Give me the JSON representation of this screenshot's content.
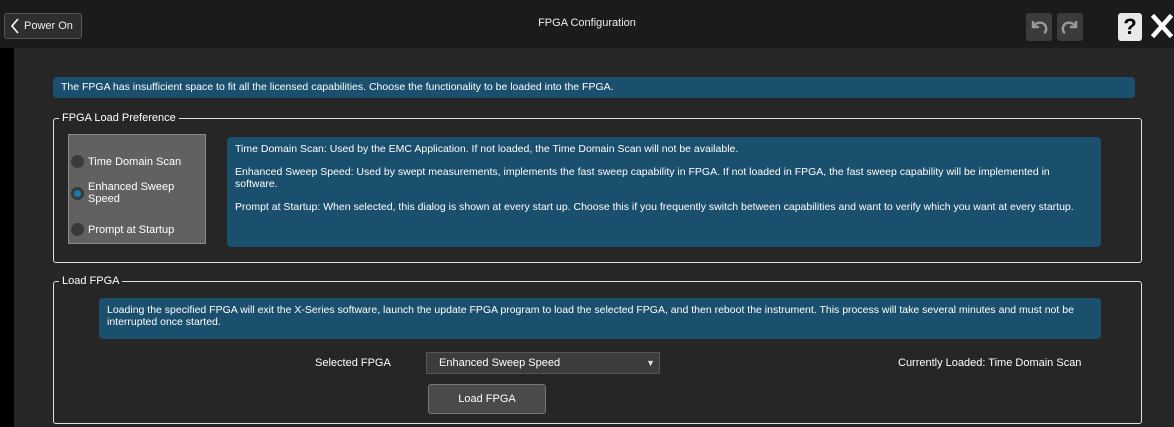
{
  "header": {
    "back_label": "Power On",
    "title": "FPGA Configuration",
    "help_label": "?"
  },
  "info": "The FPGA has insufficient space to fit all the licensed capabilities. Choose the functionality to be loaded into the FPGA.",
  "preference": {
    "title": "FPGA Load Preference",
    "options": [
      {
        "label": "Time Domain Scan",
        "selected": false
      },
      {
        "label": "Enhanced Sweep Speed",
        "selected": true
      },
      {
        "label": "Prompt at Startup",
        "selected": false
      }
    ],
    "descriptions": [
      "Time Domain Scan: Used by the EMC Application. If not loaded, the Time Domain Scan will not be available.",
      "Enhanced Sweep Speed: Used by swept measurements, implements the fast sweep capability in FPGA. If not loaded in FPGA, the fast sweep capability will be implemented in software.",
      "Prompt at Startup: When selected, this dialog is shown at every start up. Choose this if you frequently switch between capabilities and want to verify which you want at every startup."
    ]
  },
  "load": {
    "title": "Load FPGA",
    "description": "Loading the specified FPGA will exit the X-Series software, launch the update FPGA program to load the selected FPGA, and then reboot the instrument. This process will take several minutes and must not be interrupted once started.",
    "selected_label": "Selected FPGA",
    "selected_value": "Enhanced Sweep Speed",
    "current": "Currently Loaded: Time Domain Scan",
    "button_label": "Load FPGA"
  },
  "colors": {
    "accent_blue": "#1a4f6e",
    "background": "#262626",
    "titlebar": "#1b1b1b"
  },
  "icons": [
    "chevron-left-icon",
    "undo-icon",
    "redo-icon",
    "help-icon",
    "close-icon",
    "dropdown-caret-icon"
  ]
}
